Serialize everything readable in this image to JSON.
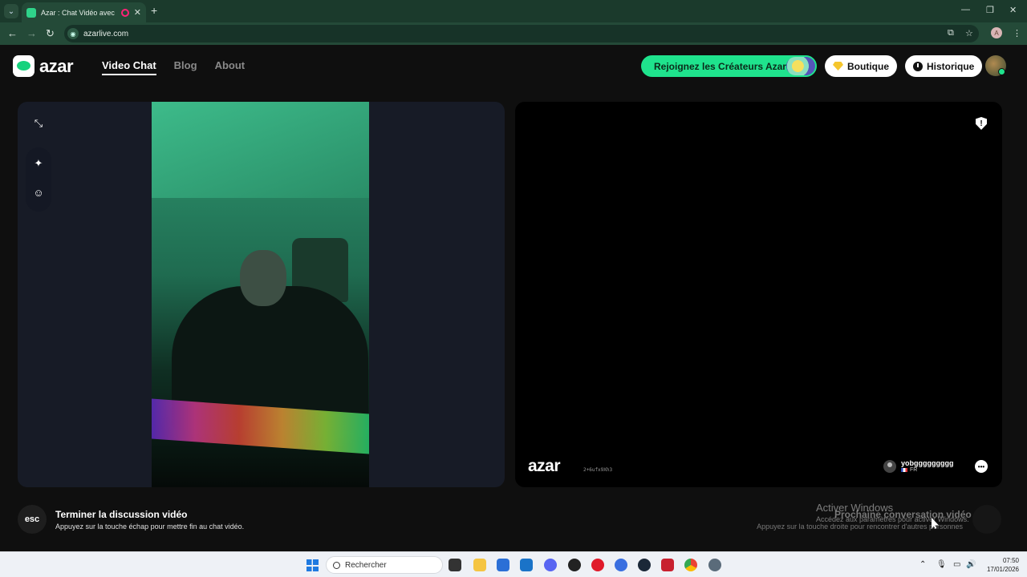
{
  "browser": {
    "tab_title": "Azar : Chat Vidéo avec de n",
    "url": "azarlive.com",
    "profile_initial": "A"
  },
  "header": {
    "logo_text": "azar",
    "nav": [
      {
        "label": "Video Chat"
      },
      {
        "label": "Blog"
      },
      {
        "label": "About"
      }
    ],
    "creators_label": "Rejoignez les Créateurs Azar",
    "boutique_label": "Boutique",
    "history_label": "Historique"
  },
  "remote": {
    "watermark": "azar",
    "watermark_id": "2+6ufx9Xh3",
    "peer_name": "yobggggggggg",
    "peer_country": "FR"
  },
  "footer": {
    "esc_key": "esc",
    "end_title": "Terminer la discussion vidéo",
    "end_subtitle": "Appuyez sur la touche échap pour mettre fin au chat vidéo.",
    "next_title": "Prochaine conversation vidéo",
    "next_subtitle": "Appuyez sur la touche droite pour rencontrer d'autres personnes"
  },
  "windows_activation": {
    "title": "Activer Windows",
    "subtitle": "Accédez aux paramètres pour activer Windows."
  },
  "taskbar": {
    "search_placeholder": "Rechercher",
    "time": "07:50",
    "date": "17/01/2026"
  },
  "colors": {
    "accent": "#1fe38d",
    "browser_frame": "#1b3a2c"
  }
}
